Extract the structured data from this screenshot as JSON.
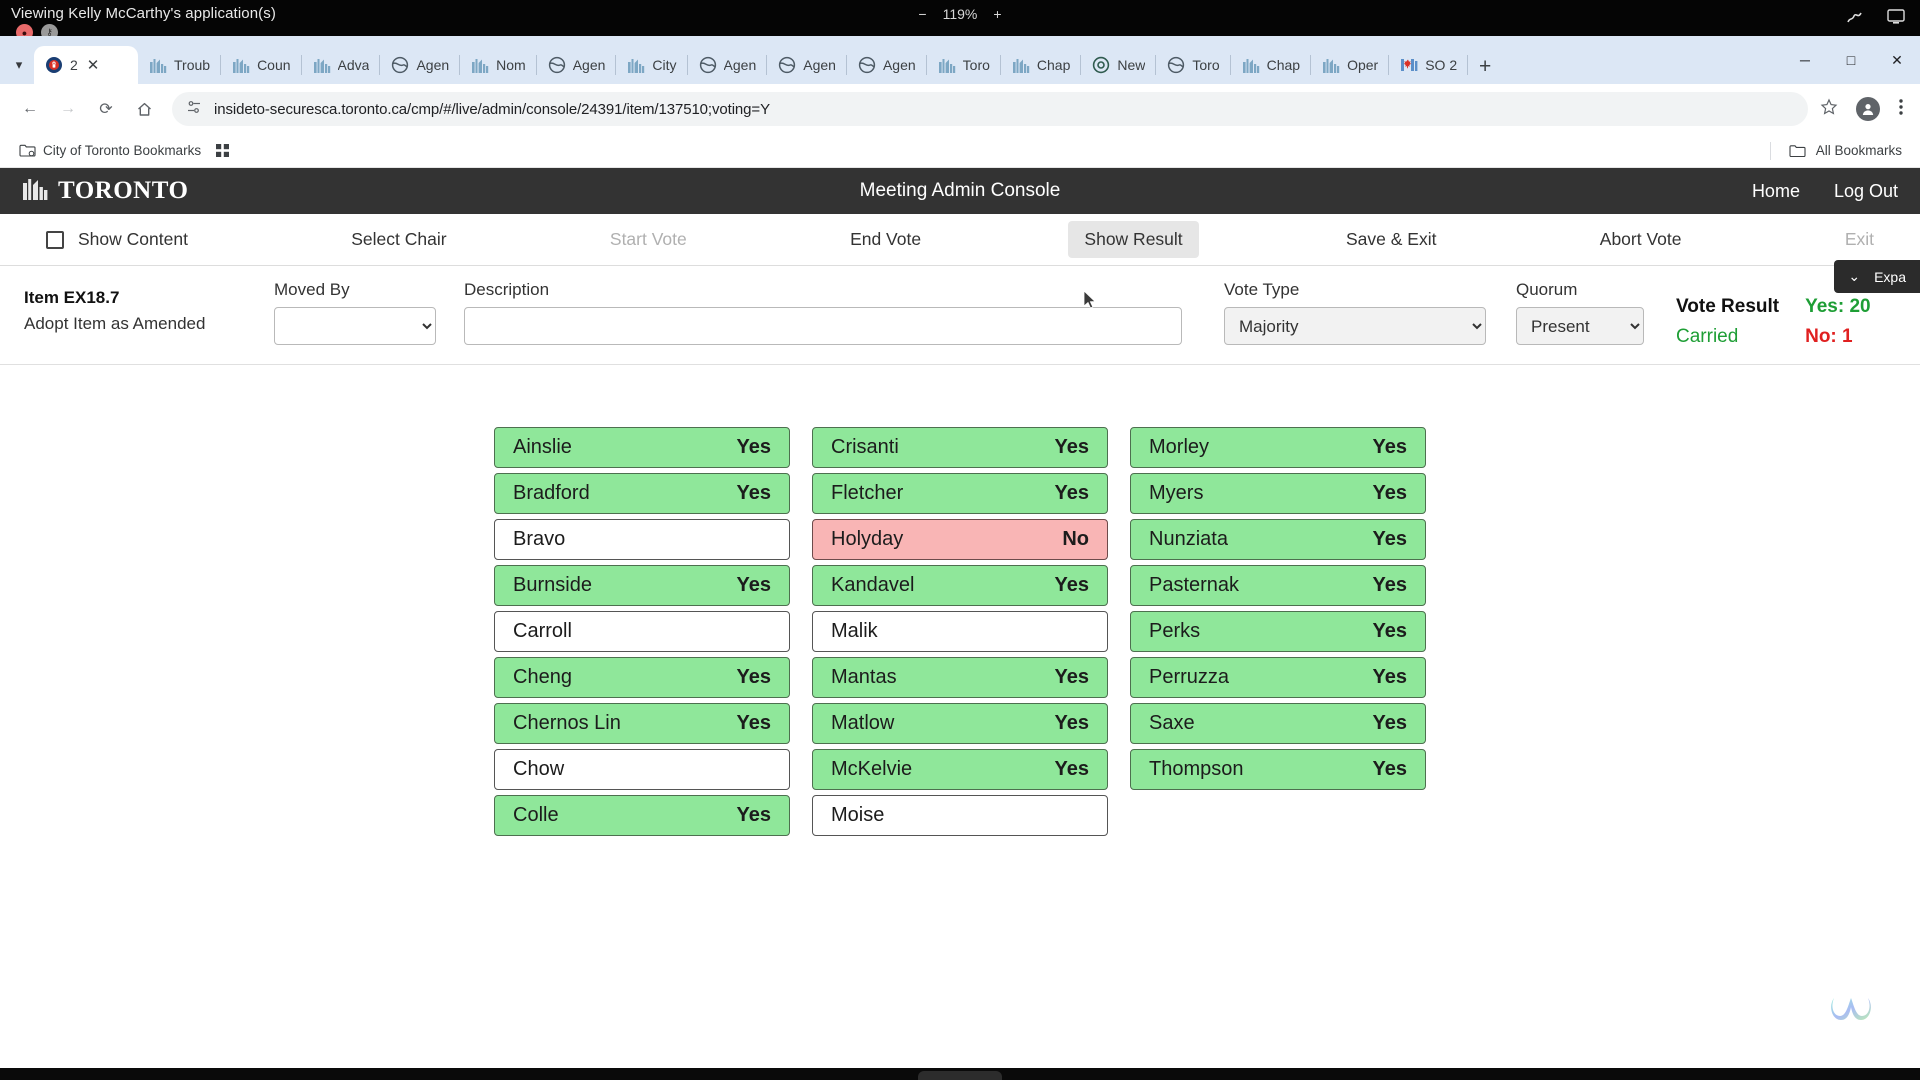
{
  "os_bar": {
    "title": "Viewing Kelly McCarthy's application(s)",
    "zoom_minus": "−",
    "zoom_level": "119%",
    "zoom_plus": "+",
    "rec_icon": "record-icon",
    "key_icon": "key-icon",
    "annotate_icon": "annotate-icon",
    "screen_icon": "screen-icon"
  },
  "browser": {
    "tabs": [
      {
        "label": "2",
        "icon": "lock-badge-icon",
        "active": true,
        "has_close": true
      },
      {
        "label": "Troub",
        "icon": "toronto-icon",
        "active": false
      },
      {
        "label": "Coun",
        "icon": "toronto-icon",
        "active": false
      },
      {
        "label": "Adva",
        "icon": "toronto-icon",
        "active": false
      },
      {
        "label": "Agen",
        "icon": "globe-icon",
        "active": false
      },
      {
        "label": "Nom",
        "icon": "toronto-icon",
        "active": false
      },
      {
        "label": "Agen",
        "icon": "globe-icon",
        "active": false
      },
      {
        "label": "City",
        "icon": "toronto-icon",
        "active": false
      },
      {
        "label": "Agen",
        "icon": "globe-icon",
        "active": false
      },
      {
        "label": "Agen",
        "icon": "globe-icon",
        "active": false
      },
      {
        "label": "Agen",
        "icon": "globe-icon",
        "active": false
      },
      {
        "label": "Toro",
        "icon": "toronto-icon",
        "active": false
      },
      {
        "label": "Chap",
        "icon": "toronto-icon",
        "active": false
      },
      {
        "label": "New",
        "icon": "chrome-icon",
        "active": false
      },
      {
        "label": "Toro",
        "icon": "globe-icon",
        "active": false
      },
      {
        "label": "Chap",
        "icon": "toronto-icon",
        "active": false
      },
      {
        "label": "Oper",
        "icon": "toronto-icon",
        "active": false
      },
      {
        "label": "SO 2",
        "icon": "canada-icon",
        "active": false
      }
    ],
    "new_tab_label": "+",
    "window_controls": {
      "minimize": "─",
      "maximize": "□",
      "close": "✕"
    },
    "nav": {
      "back": "←",
      "forward": "→",
      "reload": "⟳",
      "home": "⌂"
    },
    "url": "insideto-securesca.toronto.ca/cmp/#/live/admin/console/24391/item/137510;voting=Y",
    "site_info_icon": "site-settings-icon",
    "star_icon": "bookmark-star-icon",
    "profile_icon": "profile-avatar-icon",
    "menu_icon": "three-dot-menu-icon",
    "bookmarks": {
      "folder_label": "City of Toronto Bookmarks",
      "apps_icon": "apps-grid-icon",
      "all_bookmarks_label": "All Bookmarks"
    }
  },
  "app": {
    "brand": "TORONTO",
    "brand_icon": "toronto-skyline-icon",
    "title": "Meeting Admin Console",
    "header_links": [
      "Home",
      "Log Out"
    ],
    "toolbar": [
      {
        "label": "Show Content",
        "state": "checkbox"
      },
      {
        "label": "Select Chair",
        "state": "enabled"
      },
      {
        "label": "Start Vote",
        "state": "disabled"
      },
      {
        "label": "End Vote",
        "state": "enabled"
      },
      {
        "label": "Show Result",
        "state": "selected"
      },
      {
        "label": "Save & Exit",
        "state": "enabled"
      },
      {
        "label": "Abort Vote",
        "state": "enabled"
      },
      {
        "label": "Exit",
        "state": "disabled"
      }
    ],
    "item": {
      "id": "Item EX18.7",
      "description": "Adopt Item as Amended"
    },
    "fields": {
      "moved_by_label": "Moved By",
      "moved_by_value": "",
      "description_label": "Description",
      "description_value": "",
      "vote_type_label": "Vote Type",
      "vote_type_value": "Majority",
      "quorum_label": "Quorum",
      "quorum_value": "Present"
    },
    "result": {
      "title": "Vote Result",
      "status": "Carried",
      "yes": "Yes: 20",
      "no": "No: 1",
      "status_color": "#1e9e35",
      "no_color": "#e02020"
    },
    "expand_panel": {
      "label": "Expa",
      "chevron": "chevron-down-icon"
    },
    "vote_columns": [
      [
        {
          "name": "Ainslie",
          "vote": "Yes"
        },
        {
          "name": "Bradford",
          "vote": "Yes"
        },
        {
          "name": "Bravo",
          "vote": ""
        },
        {
          "name": "Burnside",
          "vote": "Yes"
        },
        {
          "name": "Carroll",
          "vote": ""
        },
        {
          "name": "Cheng",
          "vote": "Yes"
        },
        {
          "name": "Chernos Lin",
          "vote": "Yes"
        },
        {
          "name": "Chow",
          "vote": ""
        },
        {
          "name": "Colle",
          "vote": "Yes"
        }
      ],
      [
        {
          "name": "Crisanti",
          "vote": "Yes"
        },
        {
          "name": "Fletcher",
          "vote": "Yes"
        },
        {
          "name": "Holyday",
          "vote": "No"
        },
        {
          "name": "Kandavel",
          "vote": "Yes"
        },
        {
          "name": "Malik",
          "vote": ""
        },
        {
          "name": "Mantas",
          "vote": "Yes"
        },
        {
          "name": "Matlow",
          "vote": "Yes"
        },
        {
          "name": "McKelvie",
          "vote": "Yes"
        },
        {
          "name": "Moise",
          "vote": ""
        }
      ],
      [
        {
          "name": "Morley",
          "vote": "Yes"
        },
        {
          "name": "Myers",
          "vote": "Yes"
        },
        {
          "name": "Nunziata",
          "vote": "Yes"
        },
        {
          "name": "Pasternak",
          "vote": "Yes"
        },
        {
          "name": "Perks",
          "vote": "Yes"
        },
        {
          "name": "Perruzza",
          "vote": "Yes"
        },
        {
          "name": "Saxe",
          "vote": "Yes"
        },
        {
          "name": "Thompson",
          "vote": "Yes"
        }
      ]
    ],
    "colors": {
      "yes_bg": "#8fe79a",
      "no_bg": "#f9b5b5",
      "none_bg": "#ffffff",
      "header_bg": "#333333"
    },
    "watermark_icon": "webex-logo-icon"
  }
}
